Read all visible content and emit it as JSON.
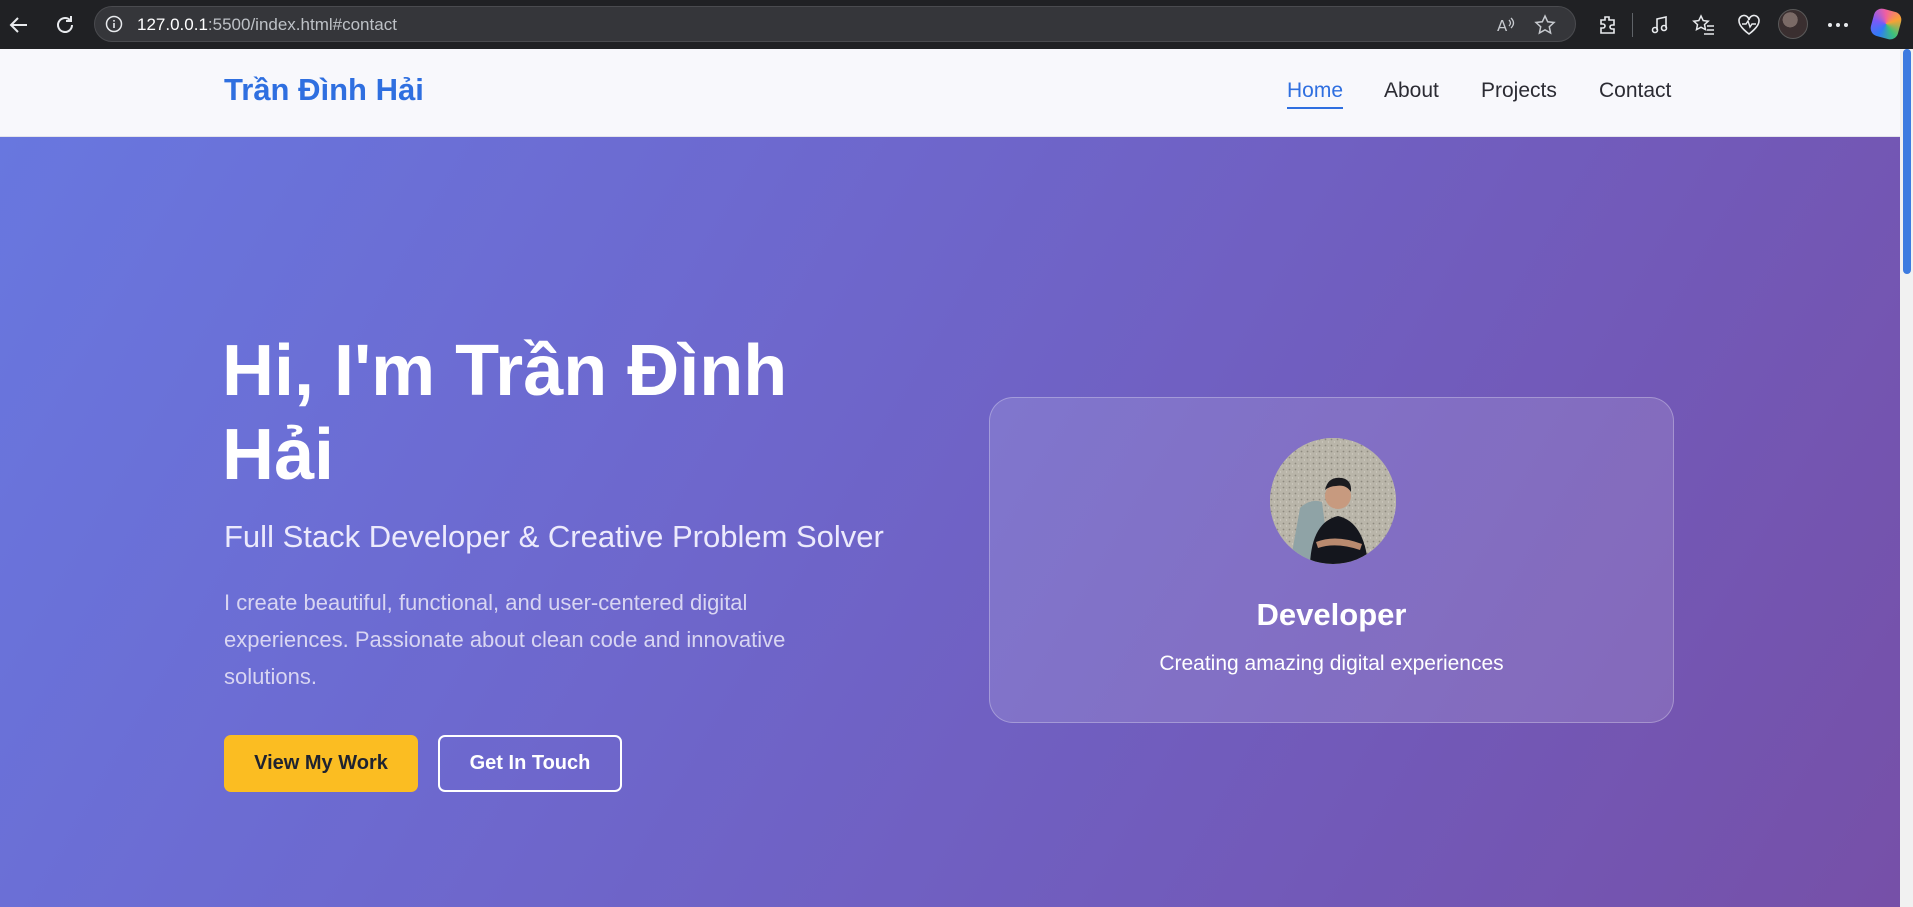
{
  "browser": {
    "url_host": "127.0.0.1",
    "url_rest": ":5500/index.html#contact",
    "icons": [
      "back-icon",
      "refresh-icon",
      "info-icon",
      "read-aloud-icon",
      "favorite-star-icon",
      "extensions-icon",
      "media-icon",
      "favorites-icon",
      "health-icon",
      "profile-avatar",
      "more-icon",
      "copilot-icon"
    ]
  },
  "nav": {
    "brand": "Trần Đình Hải",
    "links": [
      {
        "label": "Home",
        "active": true
      },
      {
        "label": "About",
        "active": false
      },
      {
        "label": "Projects",
        "active": false
      },
      {
        "label": "Contact",
        "active": false
      }
    ]
  },
  "hero": {
    "title": "Hi, I'm Trần Đình Hải",
    "subtitle": "Full Stack Developer & Creative Problem Solver",
    "description": "I create beautiful, functional, and user-centered digital experiences. Passionate about clean code and innovative solutions.",
    "primary_button": "View My Work",
    "secondary_button": "Get In Touch"
  },
  "card": {
    "role": "Developer",
    "tagline": "Creating amazing digital experiences"
  },
  "colors": {
    "brand": "#2f6fe0",
    "primary_button": "#fbbd22",
    "gradient_start": "#6878e0",
    "gradient_end": "#7650a8"
  }
}
